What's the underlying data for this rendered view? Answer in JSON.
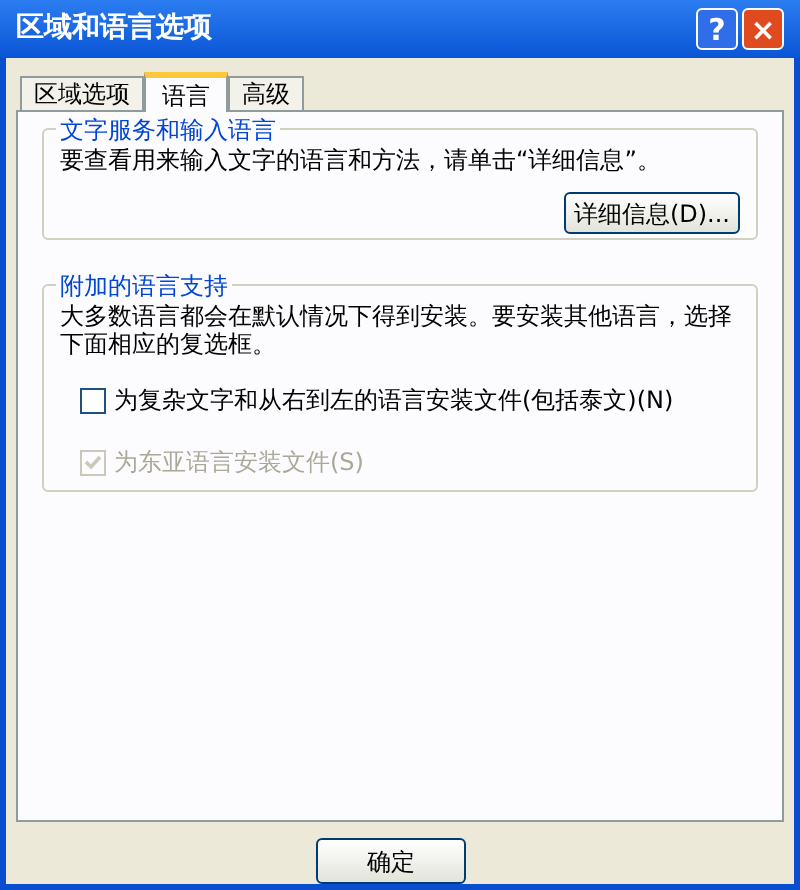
{
  "window": {
    "title": "区域和语言选项",
    "buttons": [
      {
        "kind": "help",
        "label": "?"
      },
      {
        "kind": "close",
        "label": "×"
      }
    ]
  },
  "tabs": [
    {
      "label": "区域选项",
      "selected": false
    },
    {
      "label": "语言",
      "selected": true
    },
    {
      "label": "高级",
      "selected": false
    }
  ],
  "text_services": {
    "title": "文字服务和输入语言",
    "description": "要查看用来输入文字的语言和方法，请单击“详细信息”。",
    "button": "详细信息(D)..."
  },
  "supplemental": {
    "title": "附加的语言支持",
    "description": "大多数语言都会在默认情况下得到安装。要安装其他语言，选择下面相应的复选框。",
    "checkboxes": [
      {
        "label": "为复杂文字和从右到左的语言安装文件(包括泰文)(N)",
        "checked": false,
        "disabled": false
      },
      {
        "label": "为东亚语言安装文件(S)",
        "checked": true,
        "disabled": true
      }
    ]
  },
  "buttons": [
    "确定"
  ]
}
